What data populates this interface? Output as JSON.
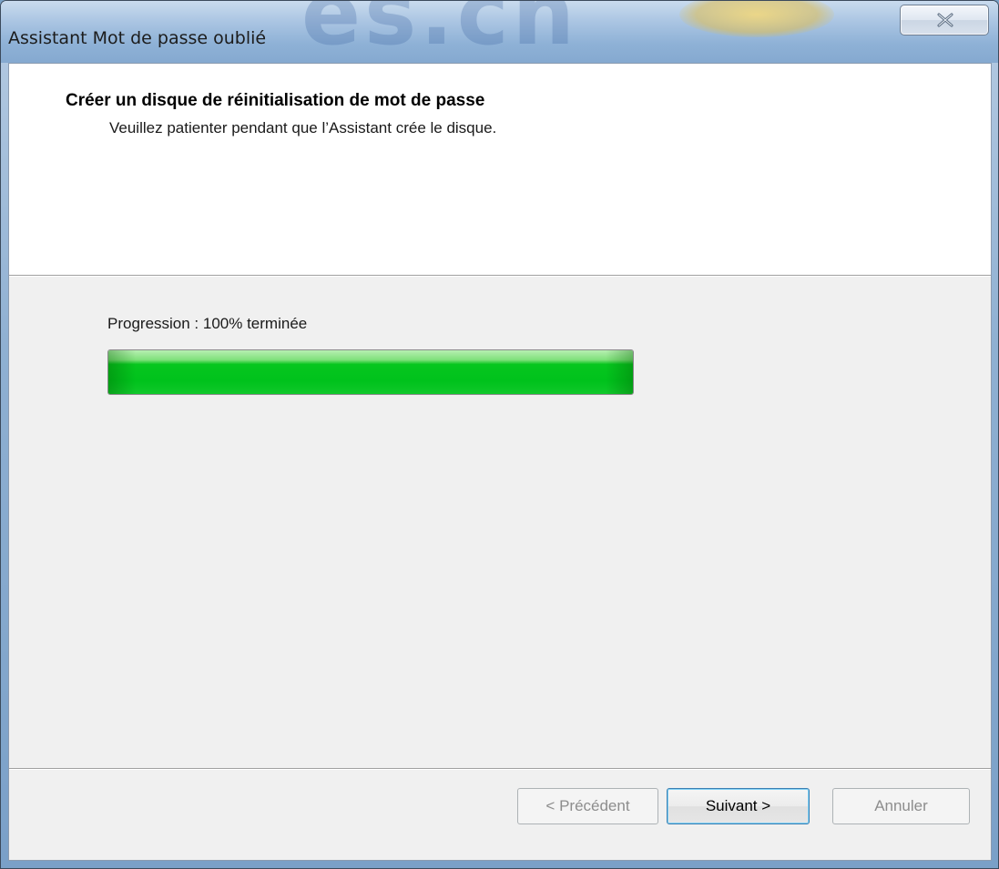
{
  "window": {
    "title": "Assistant Mot de passe oublié",
    "watermark": "es.cn",
    "close_icon": "close-icon"
  },
  "header": {
    "title": "Créer un disque de réinitialisation de mot de passe",
    "subtitle": "Veuillez patienter pendant que l’Assistant crée le disque."
  },
  "progress": {
    "label": "Progression : 100% terminée",
    "percent": 100,
    "color": "#00c21c"
  },
  "buttons": {
    "previous_label": "< Précédent",
    "next_label": "Suivant >",
    "cancel_label": "Annuler"
  }
}
